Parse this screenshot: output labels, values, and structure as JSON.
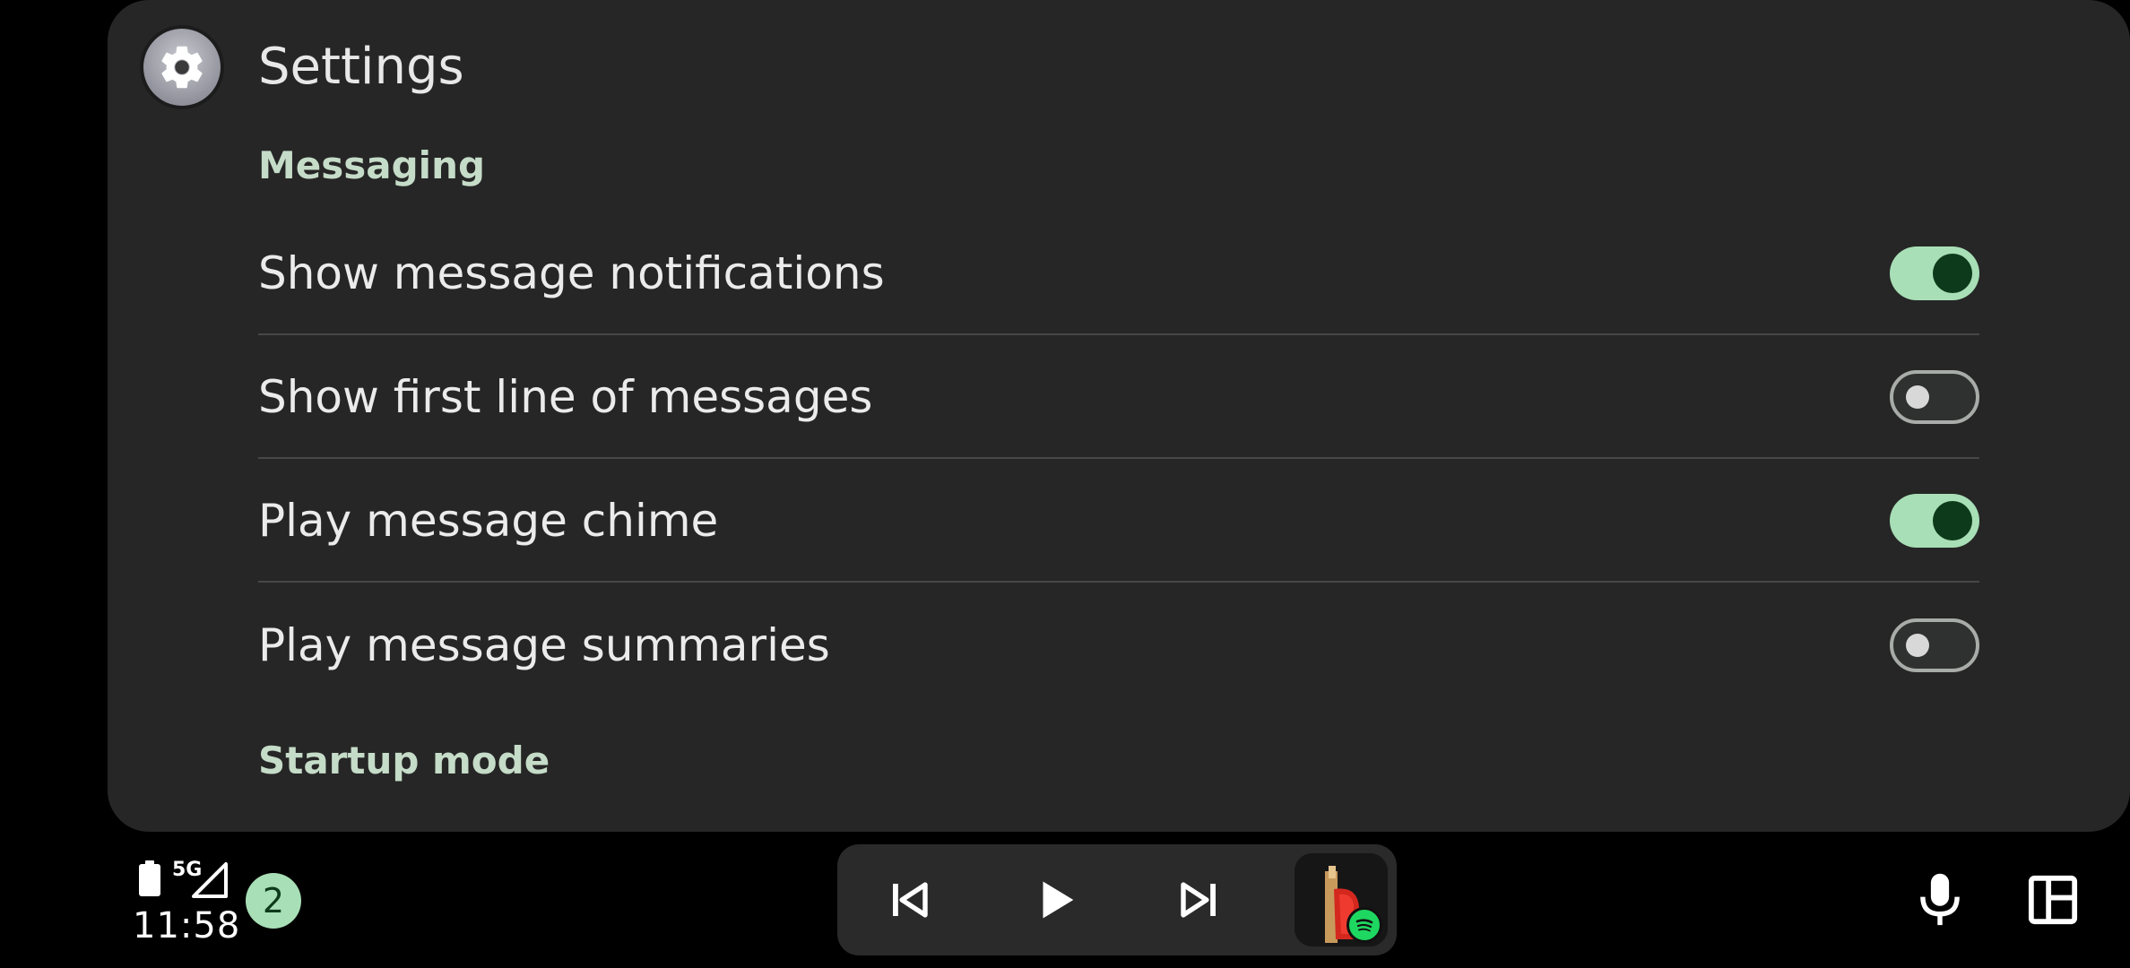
{
  "app": {
    "title": "Settings",
    "icon": "gear-icon"
  },
  "sections": [
    {
      "header": "Messaging",
      "items": [
        {
          "label": "Show message notifications",
          "toggle": true
        },
        {
          "label": "Show first line of messages",
          "toggle": false
        },
        {
          "label": "Play message chime",
          "toggle": true
        },
        {
          "label": "Play message summaries",
          "toggle": false
        }
      ]
    },
    {
      "header": "Startup mode",
      "items": []
    }
  ],
  "status": {
    "time": "11:58",
    "network": "5G",
    "battery_icon": "battery-icon",
    "signal_icon": "signal-icon",
    "notification_count": "2"
  },
  "media": {
    "prev_icon": "skip-previous-icon",
    "play_icon": "play-icon",
    "next_icon": "skip-next-icon",
    "source_icon": "spotify-icon"
  },
  "actions": {
    "mic_icon": "microphone-icon",
    "layout_icon": "dashboard-layout-icon"
  },
  "colors": {
    "panel_bg": "#262626",
    "accent_toggle_on": "#a8dfb6",
    "section_header": "#c5dcc8",
    "spotify": "#1ed760"
  }
}
